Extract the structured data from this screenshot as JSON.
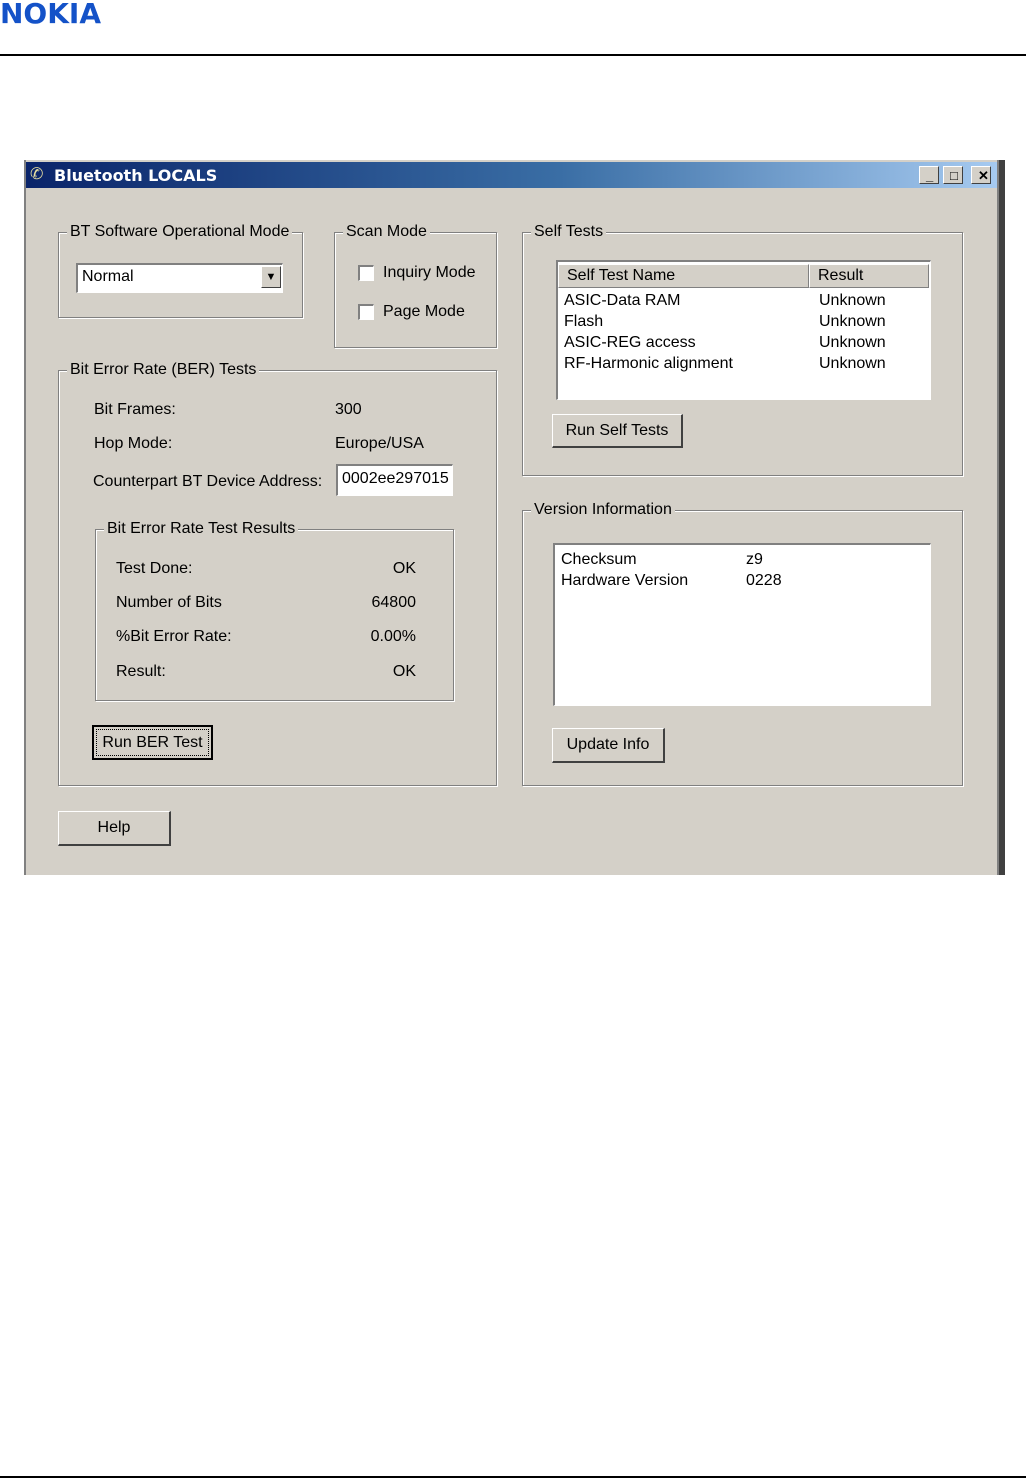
{
  "brand": "NOKIA",
  "window": {
    "title": "Bluetooth LOCALS",
    "controls": {
      "minimize": "_",
      "maximize": "□",
      "close": "✕"
    }
  },
  "op_mode": {
    "legend": "BT Software Operational Mode",
    "selected": "Normal"
  },
  "scan_mode": {
    "legend": "Scan Mode",
    "inquiry_label": "Inquiry Mode",
    "page_label": "Page Mode",
    "inquiry_checked": false,
    "page_checked": false
  },
  "ber": {
    "legend": "Bit Error Rate (BER) Tests",
    "bit_frames_label": "Bit Frames:",
    "bit_frames_value": "300",
    "hop_mode_label": "Hop Mode:",
    "hop_mode_value": "Europe/USA",
    "address_label": "Counterpart BT Device Address:",
    "address_value": "0002ee297015",
    "results": {
      "legend": "Bit Error Rate Test Results",
      "test_done_label": "Test Done:",
      "test_done_value": "OK",
      "num_bits_label": "Number of Bits",
      "num_bits_value": "64800",
      "error_rate_label": "%Bit Error Rate:",
      "error_rate_value": "0.00%",
      "result_label": "Result:",
      "result_value": "OK"
    },
    "run_button": "Run BER Test"
  },
  "self_tests": {
    "legend": "Self Tests",
    "columns": [
      "Self Test Name",
      "Result"
    ],
    "rows": [
      {
        "name": "ASIC-Data RAM",
        "result": "Unknown"
      },
      {
        "name": "Flash",
        "result": "Unknown"
      },
      {
        "name": "ASIC-REG access",
        "result": "Unknown"
      },
      {
        "name": "RF-Harmonic alignment",
        "result": "Unknown"
      }
    ],
    "run_button": "Run Self Tests"
  },
  "version_info": {
    "legend": "Version Information",
    "rows": [
      {
        "key": "Checksum",
        "value": "z9"
      },
      {
        "key": "Hardware Version",
        "value": "0228"
      }
    ],
    "update_button": "Update Info"
  },
  "help_button": "Help"
}
